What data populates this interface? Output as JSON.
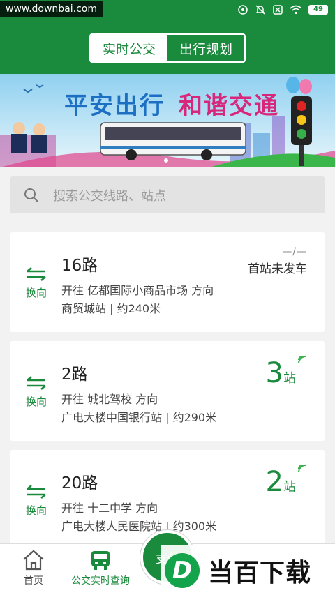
{
  "watermark": "www.downbai.com",
  "status_bar": {
    "battery": "49"
  },
  "header": {
    "tabs": [
      {
        "label": "实时公交"
      },
      {
        "label": "出行规划"
      }
    ]
  },
  "banner": {
    "slogan_left": "平安出行",
    "slogan_right": "和谐交通"
  },
  "search": {
    "placeholder": "搜索公交线路、站点"
  },
  "cards": [
    {
      "route": "16路",
      "swap_label": "换向",
      "direction": "开往 亿都国际小商品市场 方向",
      "nearest": "商贸城站 | 约240米",
      "status_dash": "—/—",
      "status_text": "首站未发车"
    },
    {
      "route": "2路",
      "swap_label": "换向",
      "direction": "开往 城北驾校 方向",
      "nearest": "广电大楼中国银行站 | 约290米",
      "stops": "3",
      "stops_unit": "站"
    },
    {
      "route": "20路",
      "swap_label": "换向",
      "direction": "开往 十二中学 方向",
      "nearest": "广电大楼人民医院站 | 约300米",
      "stops": "2",
      "stops_unit": "站"
    }
  ],
  "nav": {
    "home": "首页",
    "realtime": "公交实时查询",
    "pay": "支付"
  },
  "corner_logo": {
    "letter": "D",
    "text": "当百下载"
  },
  "colors": {
    "primary": "#1a8a3c"
  }
}
